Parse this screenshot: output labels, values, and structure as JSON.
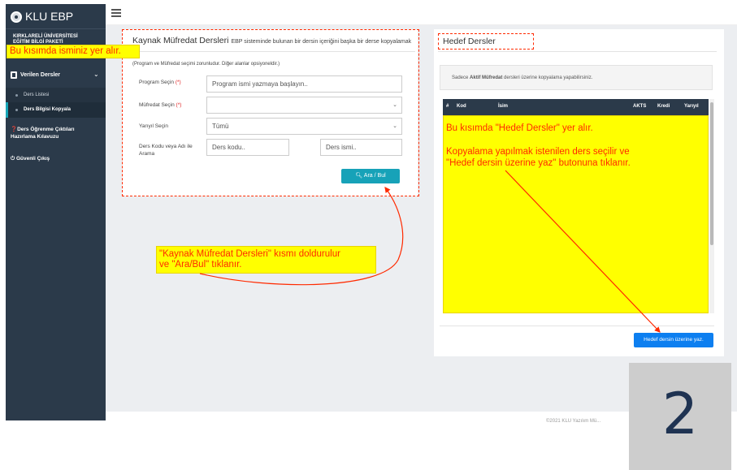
{
  "app": {
    "brand": "KLU EBP",
    "university_line1": "KIRKLARELİ ÜNİVERSİTESİ",
    "university_line2": "EĞİTİM BİLGİ PAKETİ"
  },
  "annotations": {
    "name_note": "Bu kısımda isminiz yer alır.",
    "target_note_line1": "Bu kısımda \"Hedef Dersler\" yer alır.",
    "target_note_line2": "Kopyalama yapılmak istenilen ders seçilir ve",
    "target_note_line3": "\"Hedef dersin üzerine yaz\" butonuna tıklanır.",
    "source_note_line1": "\"Kaynak Müfredat Dersleri\" kısmı doldurulur",
    "source_note_line2": "ve \"Ara/Bul\" tıklanır.",
    "step_number": "2",
    "colors": {
      "annotation_red": "#ff2a00",
      "highlight_yellow": "#ffff00"
    }
  },
  "sidebar": {
    "menu_main": {
      "label": "Verilen Dersler",
      "icon": "book-icon"
    },
    "sub_items": [
      {
        "label": "Ders Listesi"
      },
      {
        "label": "Ders Bilgisi Kopyala"
      }
    ],
    "guide": {
      "line1": "Ders Öğrenme Çıktıları",
      "line2": "Hazırlama Kılavuzu",
      "icon": "question-circle-icon"
    },
    "exit": {
      "label": "Güvenli Çıkış",
      "icon": "power-icon"
    },
    "colors": {
      "background": "#2b3a4a",
      "active_accent": "#18a6b8"
    }
  },
  "source_panel": {
    "title": "Kaynak Müfredat Dersleri",
    "subtitle": "EBP sisteminde bulunan bir dersin içeriğini başka bir derse kopyalamak",
    "required_note": "(Program ve Müfredat seçimi zorunludur. Diğer alanlar opsiyoneldir.)",
    "program_label": "Program Seçin",
    "program_placeholder": "Program ismi yazmaya başlayın..",
    "curriculum_label": "Müfredat Seçin",
    "curriculum_value": "",
    "semester_label": "Yarıyıl Seçin",
    "semester_value": "Tümü",
    "search_label_line1": "Ders Kodu veya Adı ile",
    "search_label_line2": "Arama",
    "code_placeholder": "Ders kodu..",
    "name_placeholder": "Ders ismi..",
    "required_mark": "(*)",
    "search_button": "Ara / Bul"
  },
  "target_panel": {
    "title": "Hedef Dersler",
    "info_prefix": "Sadece ",
    "info_bold": "Aktif Müfredat",
    "info_suffix": " dersleri üzerine kopyalama yapabilirsiniz.",
    "columns": [
      "#",
      "Kod",
      "İsim",
      "AKTS",
      "Kredi",
      "Yarıyıl"
    ],
    "write_button": "Hedef dersin üzerine yaz."
  },
  "footer": {
    "text": "©2021 KLU Yazılım Mü..."
  }
}
